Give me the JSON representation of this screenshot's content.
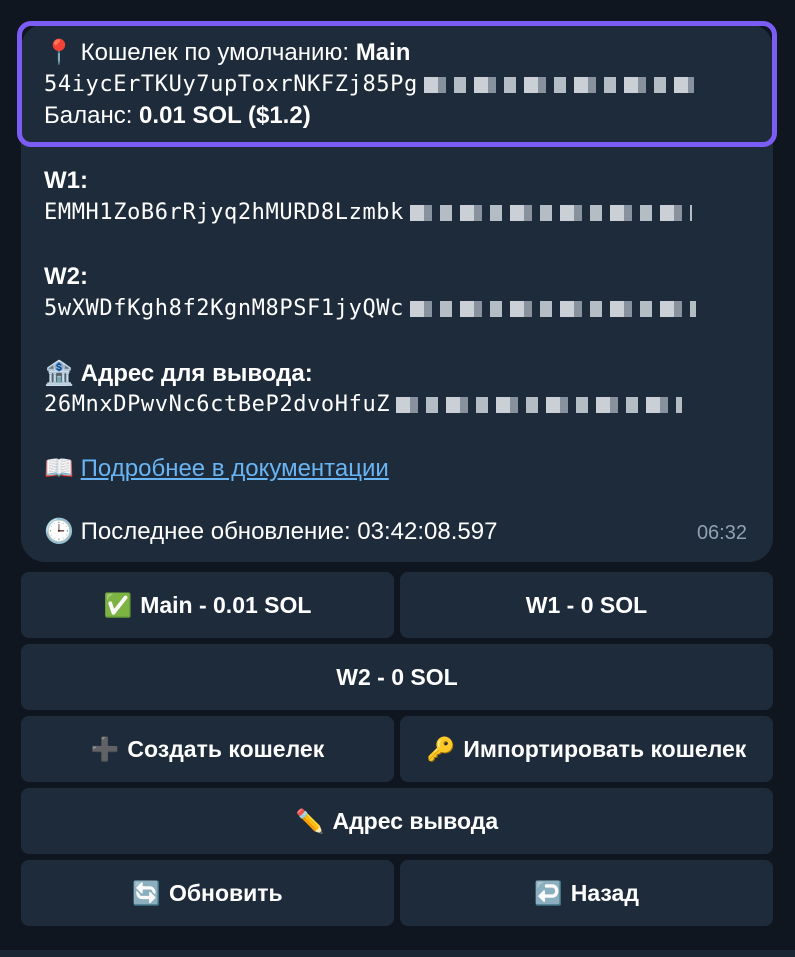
{
  "message": {
    "default_wallet_label": "Кошелек по умолчанию:",
    "default_wallet_name": "Main",
    "main_address_visible": "54iycErTKUy7upToxrNKFZj85Pg",
    "balance_label": "Баланс:",
    "balance_value": "0.01 SOL ($1.2)",
    "w1_label": "W1:",
    "w1_address_visible": "EMMH1ZoB6rRjyq2hMURD8Lzmbk",
    "w2_label": "W2:",
    "w2_address_visible": "5wXWDfKgh8f2KgnM8PSF1jyQWc",
    "withdraw_label": "Адрес для вывода:",
    "withdraw_address_visible": "26MnxDPwvNc6ctBeP2dvoHfuZ",
    "docs_link": "Подробнее в документации",
    "last_update": "Последнее обновление: 03:42:08.597",
    "time": "06:32",
    "icons": {
      "pin": "📍",
      "bank": "🏦",
      "book": "📖",
      "clock": "🕒"
    }
  },
  "buttons": {
    "main": {
      "icon": "✅",
      "label": "Main - 0.01 SOL"
    },
    "w1": {
      "label": "W1 - 0 SOL"
    },
    "w2": {
      "label": "W2 - 0 SOL"
    },
    "create": {
      "icon": "➕",
      "label": "Создать кошелек"
    },
    "import": {
      "icon": "🔑",
      "label": "Импортировать кошелек"
    },
    "withdraw": {
      "icon": "✏️",
      "label": "Адрес вывода"
    },
    "refresh": {
      "icon": "🔄",
      "label": "Обновить"
    },
    "back": {
      "icon": "↩️",
      "label": "Назад"
    }
  },
  "colors": {
    "background": "#0f1620",
    "bubble": "#1e2b3b",
    "highlight": "#7b5cf5",
    "link": "#69b4f2",
    "time": "#8ea0b3"
  }
}
